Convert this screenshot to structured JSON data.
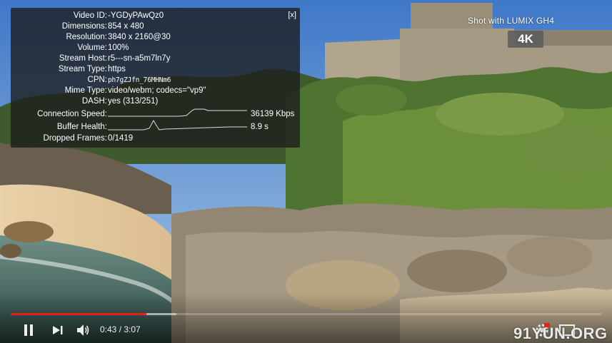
{
  "stats_panel": {
    "close_label": "[x]",
    "rows": [
      {
        "label": "Video ID:",
        "value": "-YGDyPAwQz0"
      },
      {
        "label": "Dimensions:",
        "value": "854 x 480"
      },
      {
        "label": "Resolution:",
        "value": "3840 x 2160@30"
      },
      {
        "label": "Volume:",
        "value": "100%"
      },
      {
        "label": "Stream Host:",
        "value": "r5---sn-a5m7ln7y"
      },
      {
        "label": "Stream Type:",
        "value": "https"
      },
      {
        "label": "CPN:",
        "value": "ph7gZJfn_76MHNm6"
      },
      {
        "label": "Mime Type:",
        "value": "video/webm; codecs=\"vp9\""
      },
      {
        "label": "DASH:",
        "value": "yes (313/251)"
      }
    ],
    "connection_speed": {
      "label": "Connection Speed:",
      "value": "36139 Kbps"
    },
    "buffer_health": {
      "label": "Buffer Health:",
      "value": "8.9 s"
    },
    "dropped_frames": {
      "label": "Dropped Frames:",
      "value": "0/1419"
    }
  },
  "watermark": {
    "shot_with": "Shot with LUMIX GH4",
    "badge": "4K"
  },
  "player": {
    "current_time": "0:43",
    "separator": " / ",
    "duration": "3:07",
    "played_fraction": 0.23,
    "buffered_fraction": 0.28,
    "icons": [
      "pause-icon",
      "next-icon",
      "volume-icon",
      "settings-icon",
      "miniplayer-icon"
    ],
    "accent_color": "#e62117"
  },
  "site_watermark": "91YUN.ORG"
}
